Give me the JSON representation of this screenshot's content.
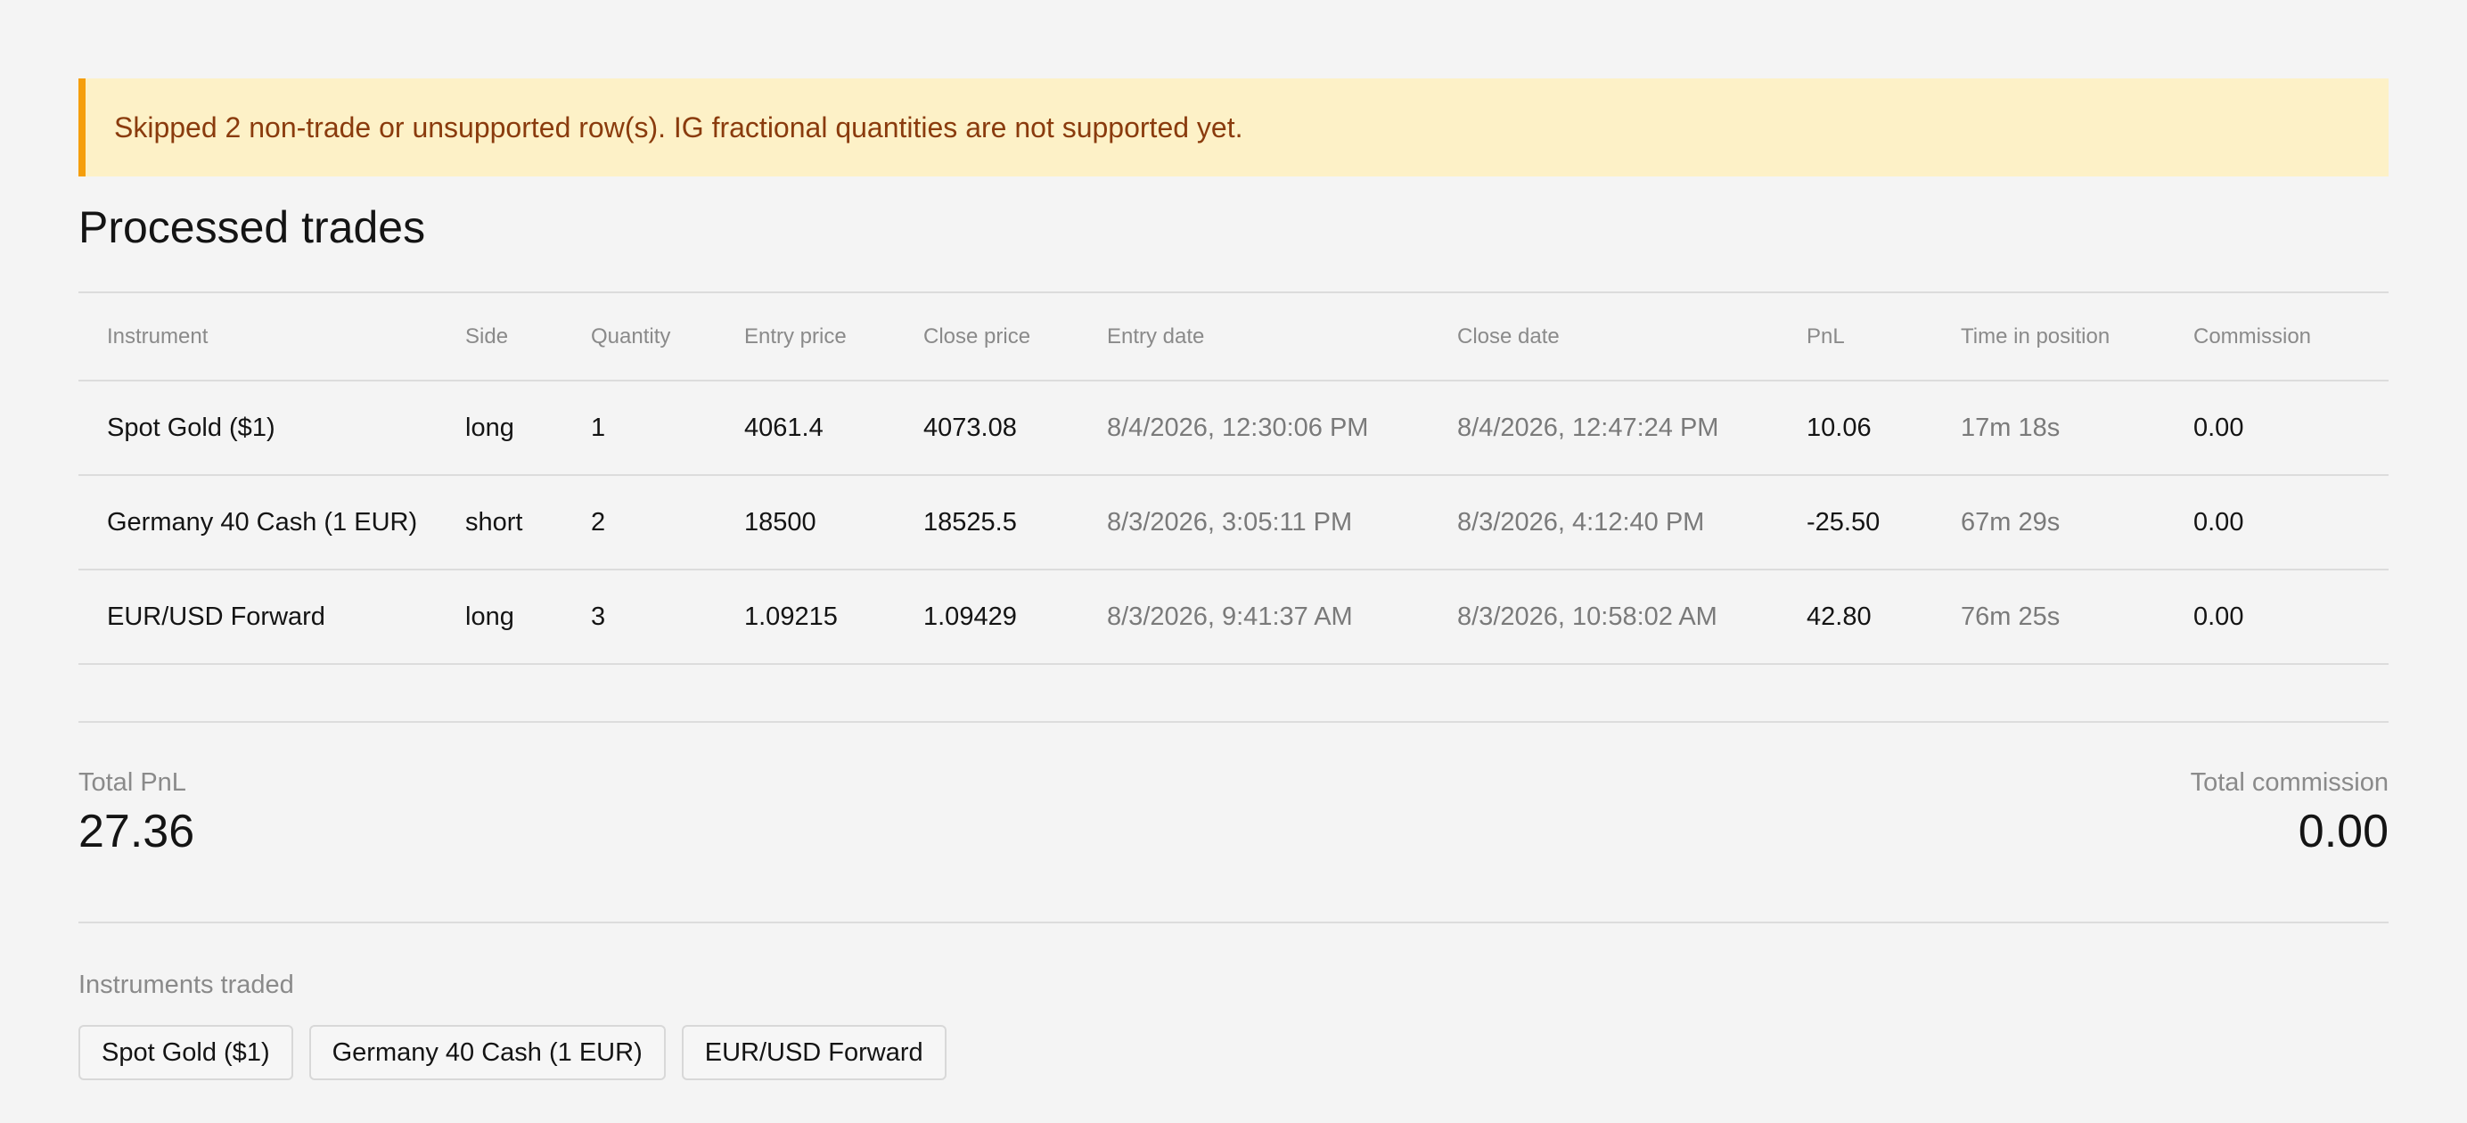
{
  "warning": {
    "text": "Skipped 2 non-trade or unsupported row(s). IG fractional quantities are not supported yet.",
    "accent_color": "#f59e0b",
    "background_color": "#fdf1c7",
    "text_color": "#8a3b0d"
  },
  "page": {
    "title": "Processed trades"
  },
  "table": {
    "columns": [
      "Instrument",
      "Side",
      "Quantity",
      "Entry price",
      "Close price",
      "Entry date",
      "Close date",
      "PnL",
      "Time in position",
      "Commission"
    ],
    "rows": [
      {
        "instrument": "Spot Gold ($1)",
        "side": "long",
        "quantity": "1",
        "entry_price": "4061.4",
        "close_price": "4073.08",
        "entry_date": "8/4/2026, 12:30:06 PM",
        "close_date": "8/4/2026, 12:47:24 PM",
        "pnl": "10.06",
        "time_in_position": "17m 18s",
        "commission": "0.00"
      },
      {
        "instrument": "Germany 40 Cash (1 EUR)",
        "side": "short",
        "quantity": "2",
        "entry_price": "18500",
        "close_price": "18525.5",
        "entry_date": "8/3/2026, 3:05:11 PM",
        "close_date": "8/3/2026, 4:12:40 PM",
        "pnl": "-25.50",
        "time_in_position": "67m 29s",
        "commission": "0.00"
      },
      {
        "instrument": "EUR/USD Forward",
        "side": "long",
        "quantity": "3",
        "entry_price": "1.09215",
        "close_price": "1.09429",
        "entry_date": "8/3/2026, 9:41:37 AM",
        "close_date": "8/3/2026, 10:58:02 AM",
        "pnl": "42.80",
        "time_in_position": "76m 25s",
        "commission": "0.00"
      }
    ]
  },
  "summary": {
    "total_pnl_label": "Total PnL",
    "total_pnl_value": "27.36",
    "total_commission_label": "Total commission",
    "total_commission_value": "0.00"
  },
  "instruments": {
    "label": "Instruments traded",
    "chips": [
      "Spot Gold ($1)",
      "Germany 40 Cash (1 EUR)",
      "EUR/USD Forward"
    ]
  }
}
